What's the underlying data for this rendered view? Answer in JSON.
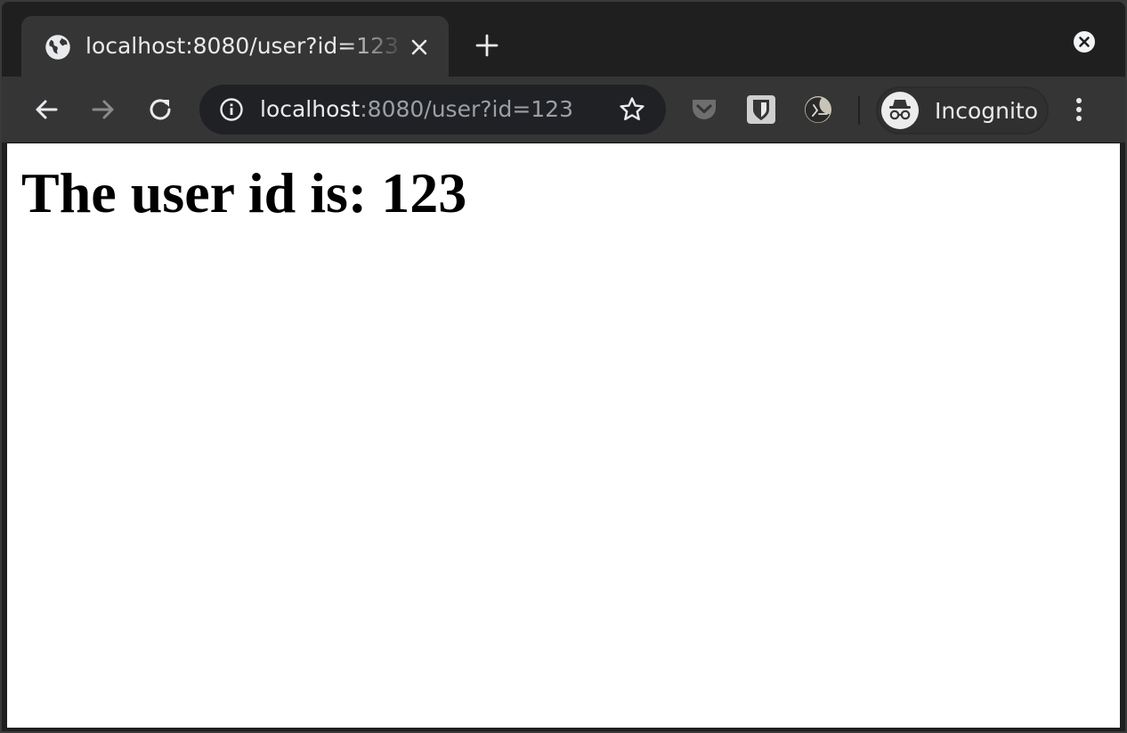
{
  "tab": {
    "title": "localhost:8080/user?id=123",
    "favicon_icon": "globe-icon",
    "close_icon": "close-icon"
  },
  "tabstrip": {
    "new_tab_icon": "plus-icon",
    "window_close_icon": "window-close-icon"
  },
  "toolbar": {
    "back_icon": "arrow-left-icon",
    "forward_icon": "arrow-right-icon",
    "reload_icon": "reload-icon",
    "omnibox": {
      "info_icon": "info-icon",
      "url_host": "localhost",
      "url_rest": ":8080/user?id=123",
      "bookmark_icon": "star-icon"
    },
    "extensions": [
      "pocket-icon",
      "bitwarden-icon",
      "dark-reader-icon"
    ],
    "incognito": {
      "label": "Incognito",
      "icon": "incognito-icon"
    },
    "menu_icon": "more-vertical-icon"
  },
  "page": {
    "heading": "The user id is: 123"
  },
  "colors": {
    "titlebar": "#1f1f1f",
    "toolbar": "#353535",
    "omnibox": "#202124",
    "text_primary": "#e8eaed",
    "text_secondary": "#9aa0a6",
    "page_background": "#ffffff"
  }
}
